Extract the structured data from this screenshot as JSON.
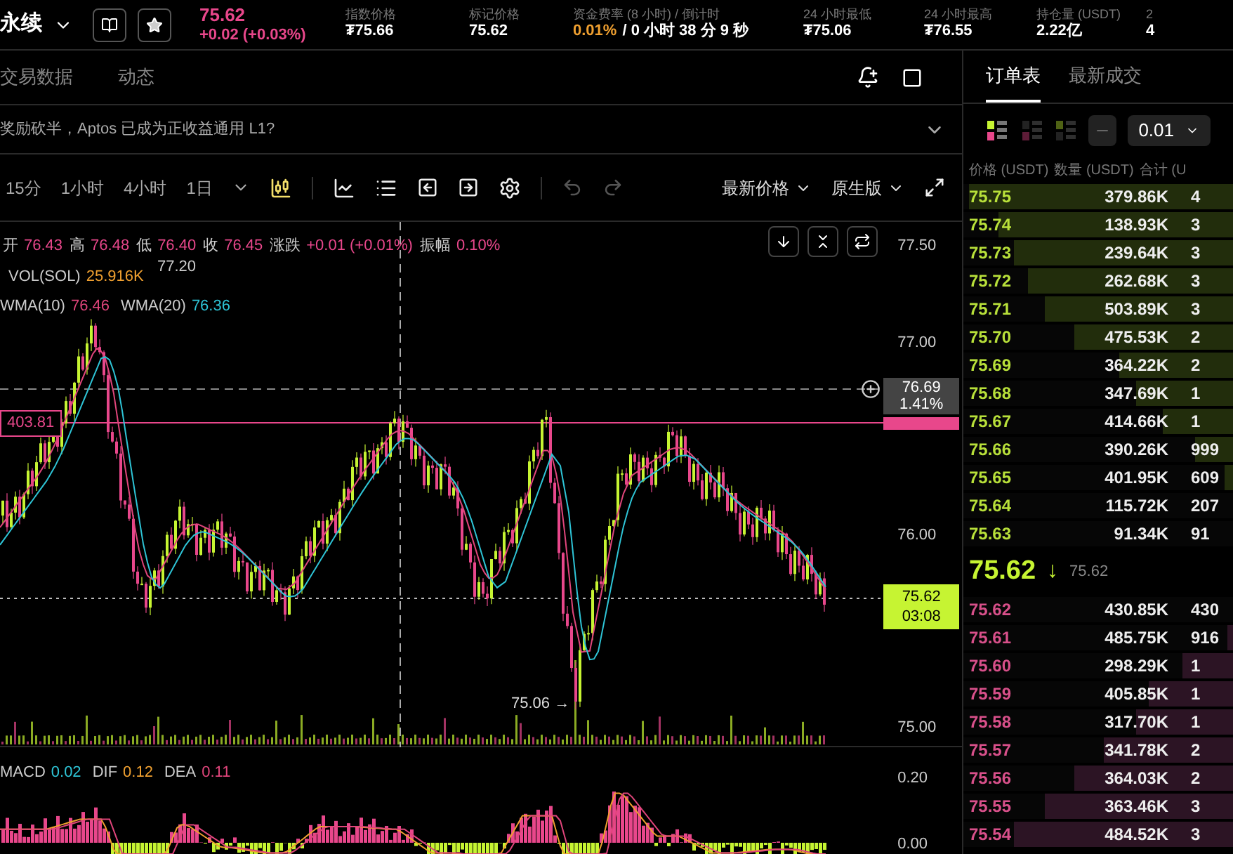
{
  "top_bar": {
    "symbol": "永续",
    "last_price": "75.62",
    "change": "+0.02 (+0.03%)",
    "stats": [
      {
        "kind": "plain",
        "label": "指数价格",
        "value": "₮75.66"
      },
      {
        "kind": "plain",
        "label": "标记价格",
        "value": "75.62"
      },
      {
        "kind": "funding",
        "label": "资金费率 (8 小时) / 倒计时",
        "rate": "0.01%",
        "value": "/ 0 小时 38 分 9 秒"
      },
      {
        "kind": "plain",
        "label": "24 小时最低",
        "value": "₮75.06"
      },
      {
        "kind": "plain",
        "label": "24 小时最高",
        "value": "₮76.55"
      },
      {
        "kind": "plain",
        "label": "持仓量 (USDT)",
        "value": "2.22亿"
      },
      {
        "kind": "plain",
        "label": "2",
        "value": "4"
      }
    ]
  },
  "tabs": [
    {
      "label": "交易数据",
      "selected": false
    },
    {
      "label": "动态",
      "selected": false
    }
  ],
  "news": "奖励砍半，Aptos 已成为正收益通用 L1?",
  "intervals": [
    "15分",
    "1小时",
    "4小时",
    "1日"
  ],
  "price_source": "最新价格",
  "chart_version": "原生版",
  "legend": {
    "ohlc": [
      {
        "label": "开",
        "value": "76.43"
      },
      {
        "label": "高",
        "value": "76.48"
      },
      {
        "label": "低",
        "value": "76.40"
      },
      {
        "label": "收",
        "value": "76.45"
      },
      {
        "label": "涨跌",
        "value": "+0.01 (+0.01%)"
      },
      {
        "label": "振幅",
        "value": "0.10%"
      }
    ],
    "vol_label": "VOL(SOL)",
    "vol_value": "25.916K",
    "wma": [
      {
        "label": "WMA(10)",
        "value": "76.46",
        "color": "#e0457b"
      },
      {
        "label": "WMA(20)",
        "value": "76.36",
        "color": "#2ec4d6"
      }
    ]
  },
  "high_label": "77.20",
  "low_label": "75.06",
  "low_arrow": "→",
  "left_label": "403.81",
  "price_axis": [
    "77.50",
    "77.00",
    "76.00",
    "75.00"
  ],
  "crosshair": {
    "price": "76.69",
    "percent": "1.41%"
  },
  "current": {
    "price": "75.62",
    "countdown": "03:08"
  },
  "macd": {
    "items": [
      {
        "label": "MACD",
        "value": "0.02",
        "color": "#2ec4d6"
      },
      {
        "label": "DIF",
        "value": "0.12",
        "color": "#f0a030"
      },
      {
        "label": "DEA",
        "value": "0.11",
        "color": "#e0457b"
      }
    ],
    "axis": [
      "0.20",
      "0.00"
    ]
  },
  "order_book": {
    "tabs": [
      {
        "label": "订单表",
        "selected": true
      },
      {
        "label": "最新成交",
        "selected": false
      }
    ],
    "views": [
      {
        "kind": "both",
        "selected": true
      },
      {
        "kind": "bids",
        "selected": false
      },
      {
        "kind": "asks",
        "selected": false
      }
    ],
    "tick": "0.01",
    "columns": [
      "价格 (USDT)",
      "数量 (USDT)",
      "合计 (U"
    ],
    "asks": [
      {
        "price": "75.75",
        "qty": "379.86K",
        "total": "4",
        "level": 0.98
      },
      {
        "price": "75.74",
        "qty": "138.93K",
        "total": "3",
        "level": 0.87
      },
      {
        "price": "75.73",
        "qty": "239.64K",
        "total": "3",
        "level": 0.81
      },
      {
        "price": "75.72",
        "qty": "262.68K",
        "total": "3",
        "level": 0.76
      },
      {
        "price": "75.71",
        "qty": "503.89K",
        "total": "3",
        "level": 0.7
      },
      {
        "price": "75.70",
        "qty": "475.53K",
        "total": "2",
        "level": 0.59
      },
      {
        "price": "75.69",
        "qty": "364.22K",
        "total": "2",
        "level": 0.42
      },
      {
        "price": "75.68",
        "qty": "347.69K",
        "total": "1",
        "level": 0.36
      },
      {
        "price": "75.67",
        "qty": "414.66K",
        "total": "1",
        "level": 0.26
      },
      {
        "price": "75.66",
        "qty": "390.26K",
        "total": "999",
        "level": 0.14
      },
      {
        "price": "75.65",
        "qty": "401.95K",
        "total": "609",
        "level": 0.03
      },
      {
        "price": "75.64",
        "qty": "115.72K",
        "total": "207"
      },
      {
        "price": "75.63",
        "qty": "91.34K",
        "total": "91"
      }
    ],
    "mid": {
      "price": "75.62",
      "arrow": "↓",
      "mark": "75.62"
    },
    "bids": [
      {
        "price": "75.62",
        "qty": "430.85K",
        "total": "430"
      },
      {
        "price": "75.61",
        "qty": "485.75K",
        "total": "916",
        "level": 0.02
      },
      {
        "price": "75.60",
        "qty": "298.29K",
        "total": "1",
        "level": 0.19
      },
      {
        "price": "75.59",
        "qty": "405.85K",
        "total": "1",
        "level": 0.31
      },
      {
        "price": "75.58",
        "qty": "317.70K",
        "total": "1",
        "level": 0.36
      },
      {
        "price": "75.57",
        "qty": "341.78K",
        "total": "2",
        "level": 0.48
      },
      {
        "price": "75.56",
        "qty": "364.03K",
        "total": "2",
        "level": 0.59
      },
      {
        "price": "75.55",
        "qty": "363.46K",
        "total": "3",
        "level": 0.7
      },
      {
        "price": "75.54",
        "qty": "484.52K",
        "total": "3",
        "level": 0.81
      }
    ]
  }
}
